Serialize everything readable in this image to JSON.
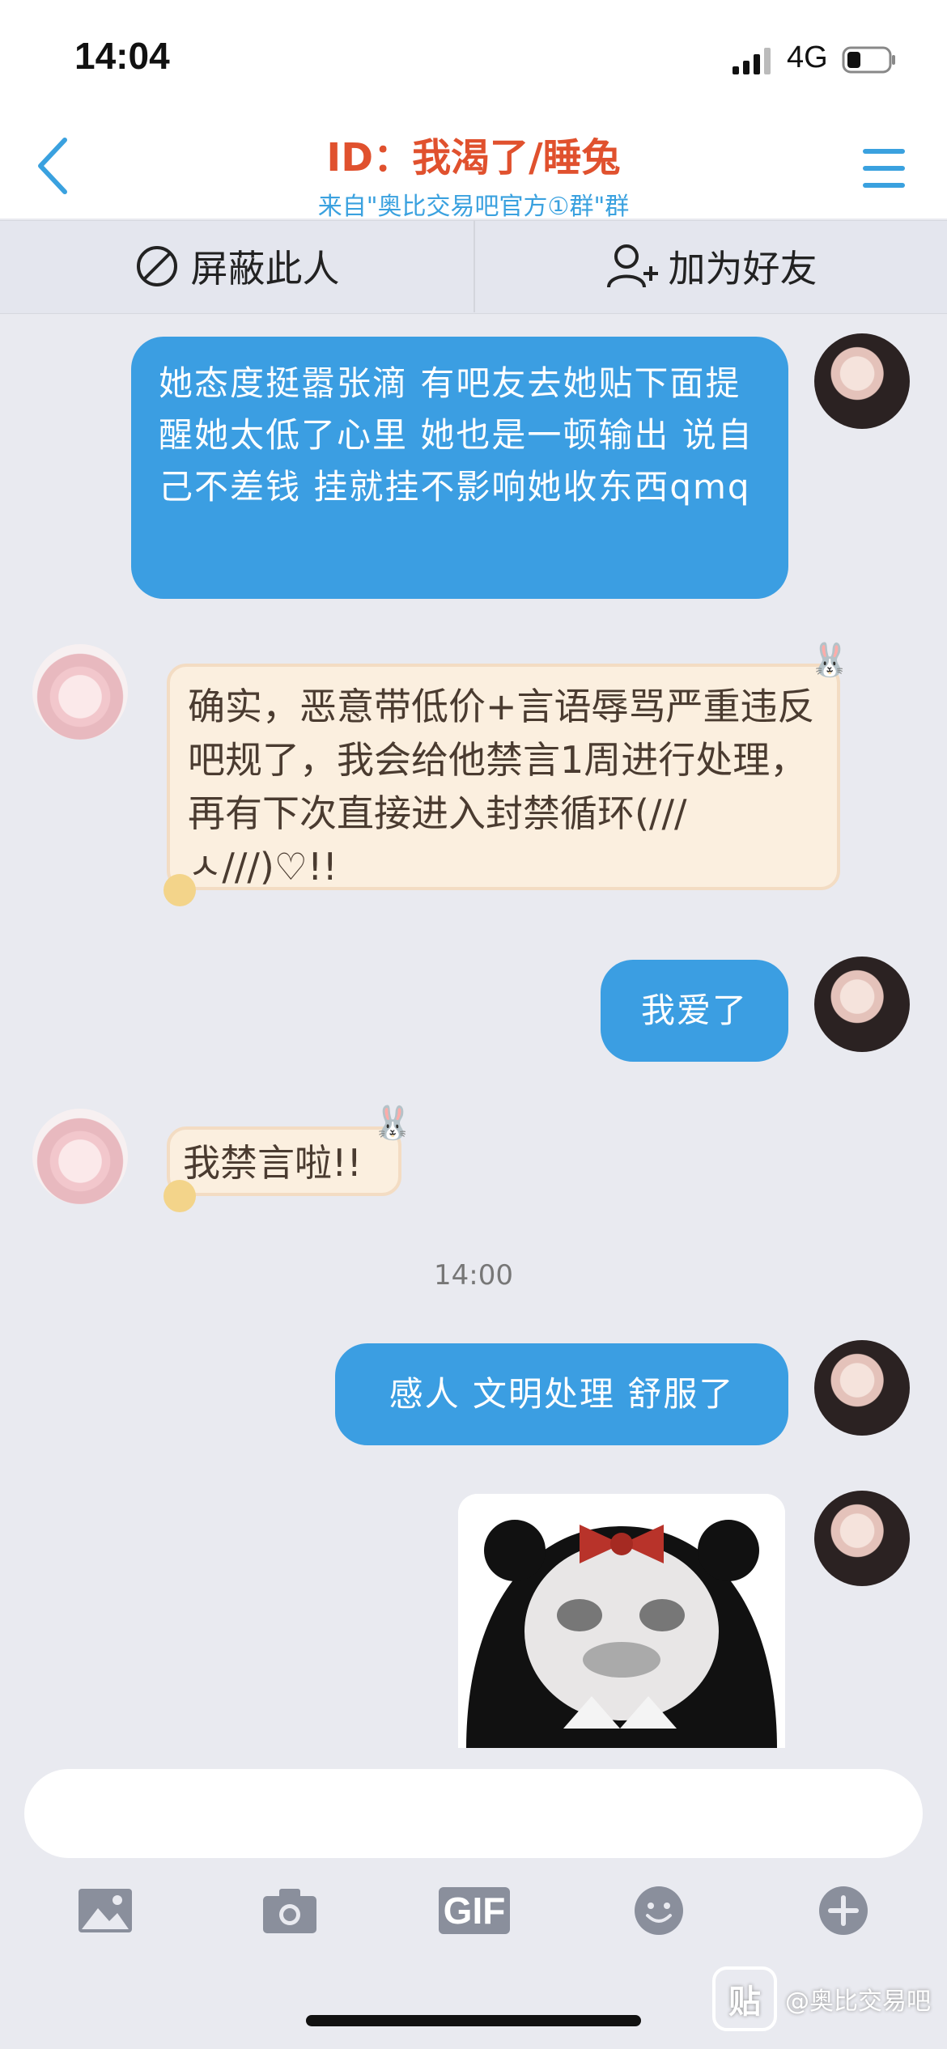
{
  "status_bar": {
    "time": "14:04",
    "network": "4G"
  },
  "header": {
    "title": "ID：我渴了/睡兔",
    "subtitle": "来自\"奥比交易吧官方①群\"群"
  },
  "actions": {
    "block_label": "屏蔽此人",
    "add_friend_label": "加为好友"
  },
  "messages": [
    {
      "side": "right",
      "text": "她态度挺嚣张滴 有吧友去她贴下面提醒她太低了心里 她也是一顿输出 说自己不差钱 挂就挂不影响她收东西qmq"
    },
    {
      "side": "left",
      "text": "确实，恶意带低价+言语辱骂严重违反吧规了，我会给他禁言1周进行处理，再有下次直接进入封禁循环(///ㅅ///)♡!!"
    },
    {
      "side": "right",
      "text": "我爱了"
    },
    {
      "side": "left",
      "text": "我禁言啦!!"
    },
    {
      "side": "right",
      "text": "感人 文明处理 舒服了"
    }
  ],
  "timestamp": "14:00",
  "input": {
    "placeholder": ""
  },
  "toolbar": {
    "gif_label": "GIF"
  },
  "watermark": {
    "logo_char": "贴",
    "text": "@奥比交易吧"
  },
  "colors": {
    "accent_blue": "#3b9ee2",
    "title_red": "#e0512e",
    "background": "#e9eaf0"
  }
}
